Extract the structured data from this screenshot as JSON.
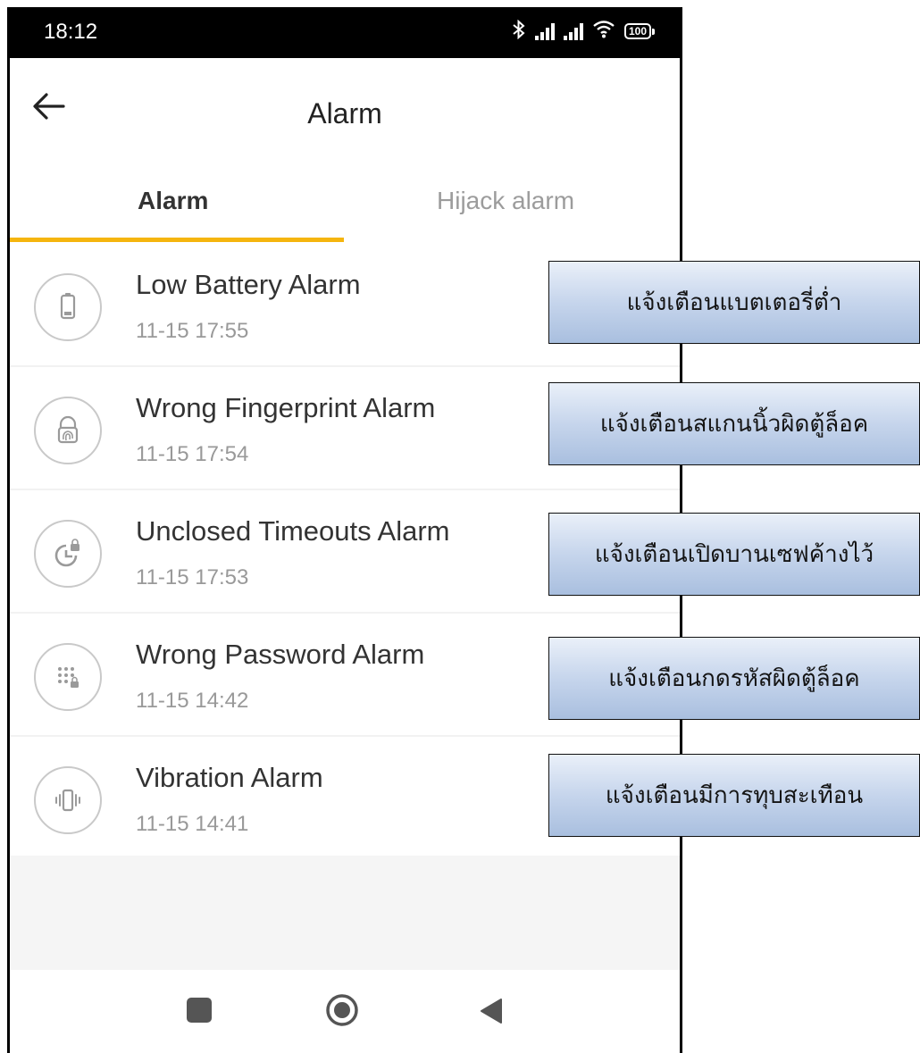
{
  "status_bar": {
    "time": "18:12",
    "battery": "100",
    "icons": [
      "bluetooth-icon",
      "signal-icon",
      "signal-icon",
      "wifi-icon",
      "battery-icon"
    ]
  },
  "app_bar": {
    "title": "Alarm",
    "back_icon": "arrow-left-icon"
  },
  "tabs": [
    {
      "label": "Alarm",
      "selected": true
    },
    {
      "label": "Hijack alarm",
      "selected": false
    }
  ],
  "colors": {
    "accent": "#f5b50e",
    "callout_fill": "#c6d5ec",
    "status_bar": "#000000"
  },
  "alarms": [
    {
      "title": "Low Battery Alarm",
      "time": "11-15 17:55",
      "icon": "battery-icon"
    },
    {
      "title": "Wrong Fingerprint Alarm",
      "time": "11-15 17:54",
      "icon": "fingerprint-lock-icon"
    },
    {
      "title": "Unclosed Timeouts Alarm",
      "time": "11-15 17:53",
      "icon": "timeout-lock-icon"
    },
    {
      "title": "Wrong Password Alarm",
      "time": "11-15 14:42",
      "icon": "keypad-lock-icon"
    },
    {
      "title": "Vibration Alarm",
      "time": "11-15 14:41",
      "icon": "vibration-icon"
    }
  ],
  "callouts": [
    "แจ้งเตือนแบตเตอรี่ต่ำ",
    "แจ้งเตือนสแกนนิ้วผิดตู้ล็อค",
    "แจ้งเตือนเปิดบานเซฟค้างไว้",
    "แจ้งเตือนกดรหัสผิดตู้ล็อค",
    "แจ้งเตือนมีการทุบสะเทือน"
  ],
  "nav_bar": {
    "icons": [
      "recents-square-icon",
      "home-circle-icon",
      "back-triangle-icon"
    ]
  }
}
